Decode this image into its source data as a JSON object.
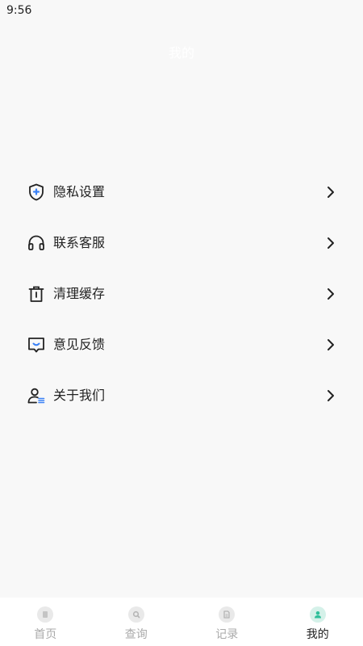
{
  "status_bar": {
    "time": "9:56"
  },
  "header": {
    "title": "我的"
  },
  "menu": {
    "items": [
      {
        "label": "隐私设置",
        "icon": "shield-plus-icon"
      },
      {
        "label": "联系客服",
        "icon": "headset-icon"
      },
      {
        "label": "清理缓存",
        "icon": "trash-icon"
      },
      {
        "label": "意见反馈",
        "icon": "feedback-chat-icon"
      },
      {
        "label": "关于我们",
        "icon": "user-info-icon"
      }
    ]
  },
  "tab_bar": {
    "tabs": [
      {
        "label": "首页",
        "icon": "home-icon",
        "active": false
      },
      {
        "label": "查询",
        "icon": "search-icon",
        "active": false
      },
      {
        "label": "记录",
        "icon": "document-icon",
        "active": false
      },
      {
        "label": "我的",
        "icon": "profile-icon",
        "active": true
      }
    ]
  },
  "colors": {
    "accent": "#3b82f6",
    "active_tab": "#2fbf9a",
    "icon_stroke": "#222222",
    "inactive_tab_text": "#aaaaaa"
  }
}
